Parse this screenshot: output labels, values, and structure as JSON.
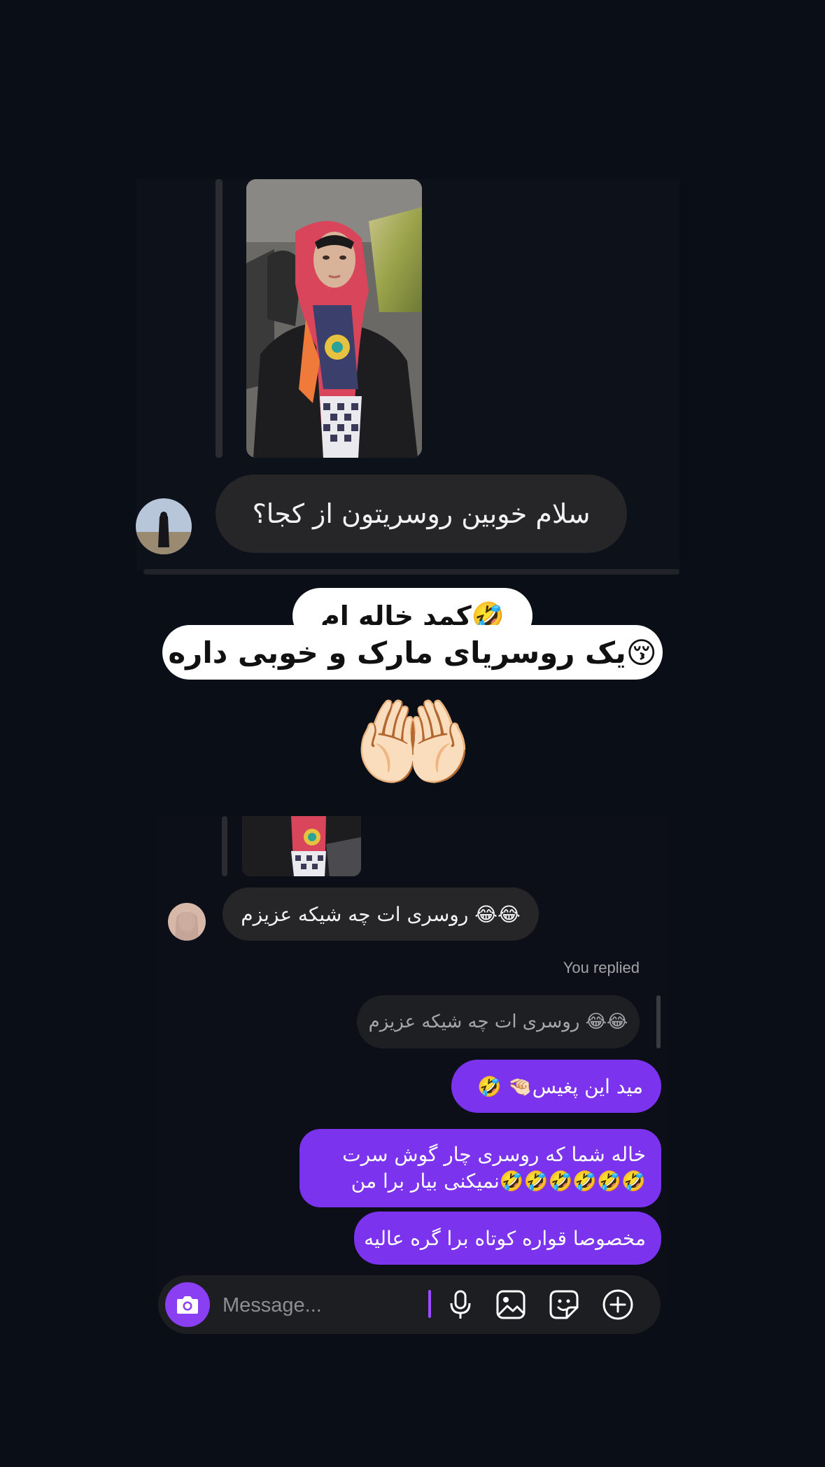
{
  "thread": {
    "story_reply_message": "سلام خوبین روسریتون از کجا؟",
    "caption_line1": "کمد خاله ام🤣",
    "caption_line2": "یک روسریای مارک و خوبی داره😚",
    "hands_emoji": "🤲🏻",
    "incoming_message": "روسری ات چه شیکه عزیزم 😂😂",
    "you_replied_label": "You replied",
    "quoted_message": "روسری ات چه شیکه عزیزم 😂😂",
    "outgoing_messages": [
      "🤣 🤏🏻مید این پغیس",
      "خاله شما که روسری چار گوش سرت نمیکنی بیار برا من🤣🤣🤣🤣🤣🤣",
      "مخصوصا قواره کوتاه برا گره عالیه"
    ]
  },
  "composer": {
    "placeholder": "Message...",
    "icons": [
      "camera-icon",
      "microphone-icon",
      "gallery-icon",
      "sticker-icon",
      "plus-icon"
    ]
  },
  "colors": {
    "background": "#0a0e16",
    "outgoing_bubble": "#7b33ee",
    "incoming_bubble": "#262628",
    "camera_button": "#8a3ff3"
  }
}
